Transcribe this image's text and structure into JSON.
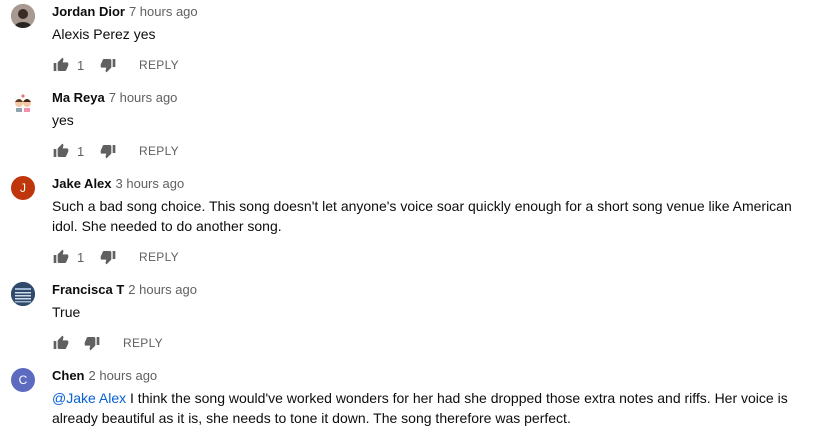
{
  "comments": [
    {
      "author": "Jordan Dior",
      "time": "7 hours ago",
      "text": "Alexis Perez yes",
      "likes": "1",
      "reply_label": "REPLY",
      "avatar_initial": "",
      "avatar_color": "#8a7a70"
    },
    {
      "author": "Ma Reya",
      "time": "7 hours ago",
      "text": "yes",
      "likes": "1",
      "reply_label": "REPLY",
      "avatar_initial": "",
      "avatar_color": "#ffffff"
    },
    {
      "author": "Jake Alex",
      "time": "3 hours ago",
      "text": "Such a bad song choice. This song doesn't let anyone's voice soar quickly enough for a short song venue like American idol. She needed to do another song.",
      "likes": "1",
      "reply_label": "REPLY",
      "avatar_initial": "J",
      "avatar_color": "#bf360c"
    },
    {
      "author": "Francisca T",
      "time": "2 hours ago",
      "text": "True",
      "likes": "",
      "reply_label": "REPLY",
      "avatar_initial": "",
      "avatar_color": "#2f4a6b"
    },
    {
      "author": "Chen",
      "time": "2 hours ago",
      "mention": "@Jake Alex",
      "text": " I think the song would've worked wonders for her had she dropped those extra notes and riffs. Her voice is already beautiful as it is, she needs to tone it down. The song therefore was perfect.",
      "avatar_initial": "C",
      "avatar_color": "#5c6bc0"
    }
  ]
}
